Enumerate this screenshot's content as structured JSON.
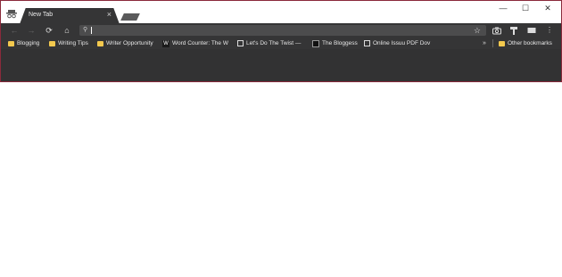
{
  "tab": {
    "title": "New Tab",
    "close": "×"
  },
  "window_controls": {
    "minimize": "—",
    "maximize": "☐",
    "close": "✕"
  },
  "toolbar": {
    "back": "←",
    "forward": "→",
    "reload": "⟳",
    "home": "⌂",
    "search_glyph": "⚲",
    "bookmark_star": "☆",
    "menu": "⋮"
  },
  "bookmarks": [
    {
      "label": "Blogging",
      "icon": "folder-icon"
    },
    {
      "label": "Writing Tips",
      "icon": "folder-icon"
    },
    {
      "label": "Writer Opportunity",
      "icon": "folder-icon"
    },
    {
      "label": "Word Counter: The W",
      "icon": "w-icon",
      "icon_text": "W"
    },
    {
      "label": "Let's Do The Twist —",
      "icon": "page-icon"
    },
    {
      "label": "The Bloggess",
      "icon": "dark-icon"
    },
    {
      "label": "Online Issuu PDF Dov",
      "icon": "page-icon"
    }
  ],
  "bookmarks_more": "»",
  "other_bookmarks": "Other bookmarks",
  "colors": {
    "tab_bg": "#353536",
    "toolbar_bg": "#353536",
    "folder": "#f3c94e",
    "frame_border": "#8a2a3b"
  }
}
